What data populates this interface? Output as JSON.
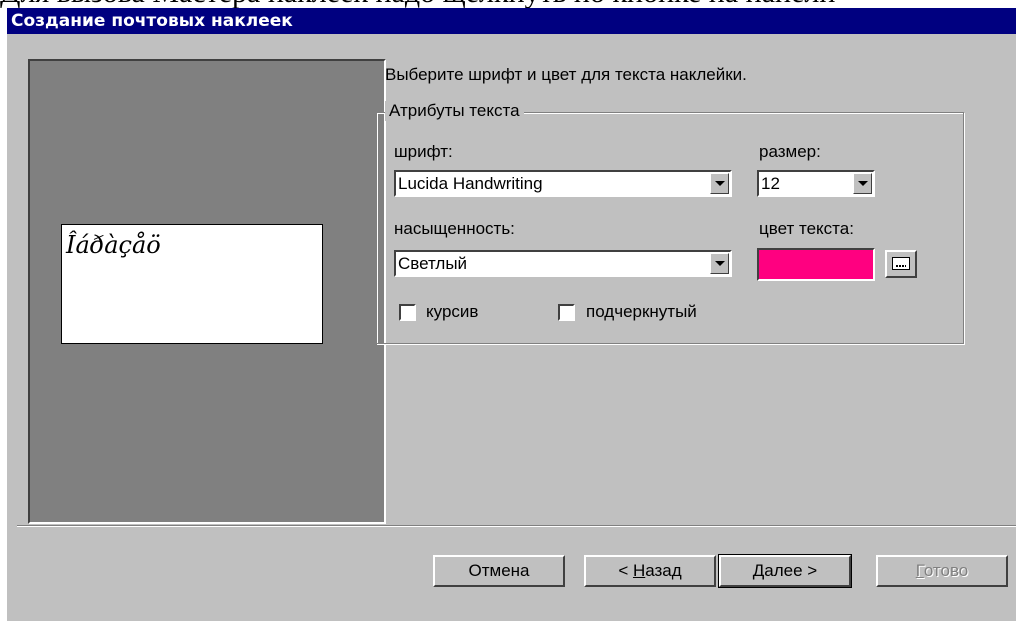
{
  "cropped_header_text": "Для вызова Мастера наклеек надо щелкнуть по кнопке на панели",
  "window": {
    "title": "Создание почтовых наклеек"
  },
  "preview": {
    "sample_text": "Îáðàçåö"
  },
  "prompt": "Выберите шрифт и цвет для текста наклейки.",
  "text_attributes": {
    "group_label": "Атрибуты текста",
    "font": {
      "label": "шрифт:",
      "value": "Lucida Handwriting"
    },
    "size": {
      "label": "размер:",
      "value": "12"
    },
    "weight": {
      "label": "насыщенность:",
      "value": "Светлый"
    },
    "color": {
      "label": "цвет текста:",
      "value": "#ff0080",
      "button_icon": "ellipsis-icon"
    },
    "italic": {
      "label": "курсив",
      "checked": false
    },
    "underline": {
      "label": "подчеркнутый",
      "checked": false
    }
  },
  "buttons": {
    "cancel": "Отмена",
    "back_prefix": "< ",
    "back_mnemonic": "Н",
    "back_rest": "азад",
    "next_mnemonic": "Д",
    "next_rest": "алее >",
    "finish_mnemonic": "Г",
    "finish_rest": "отово"
  }
}
